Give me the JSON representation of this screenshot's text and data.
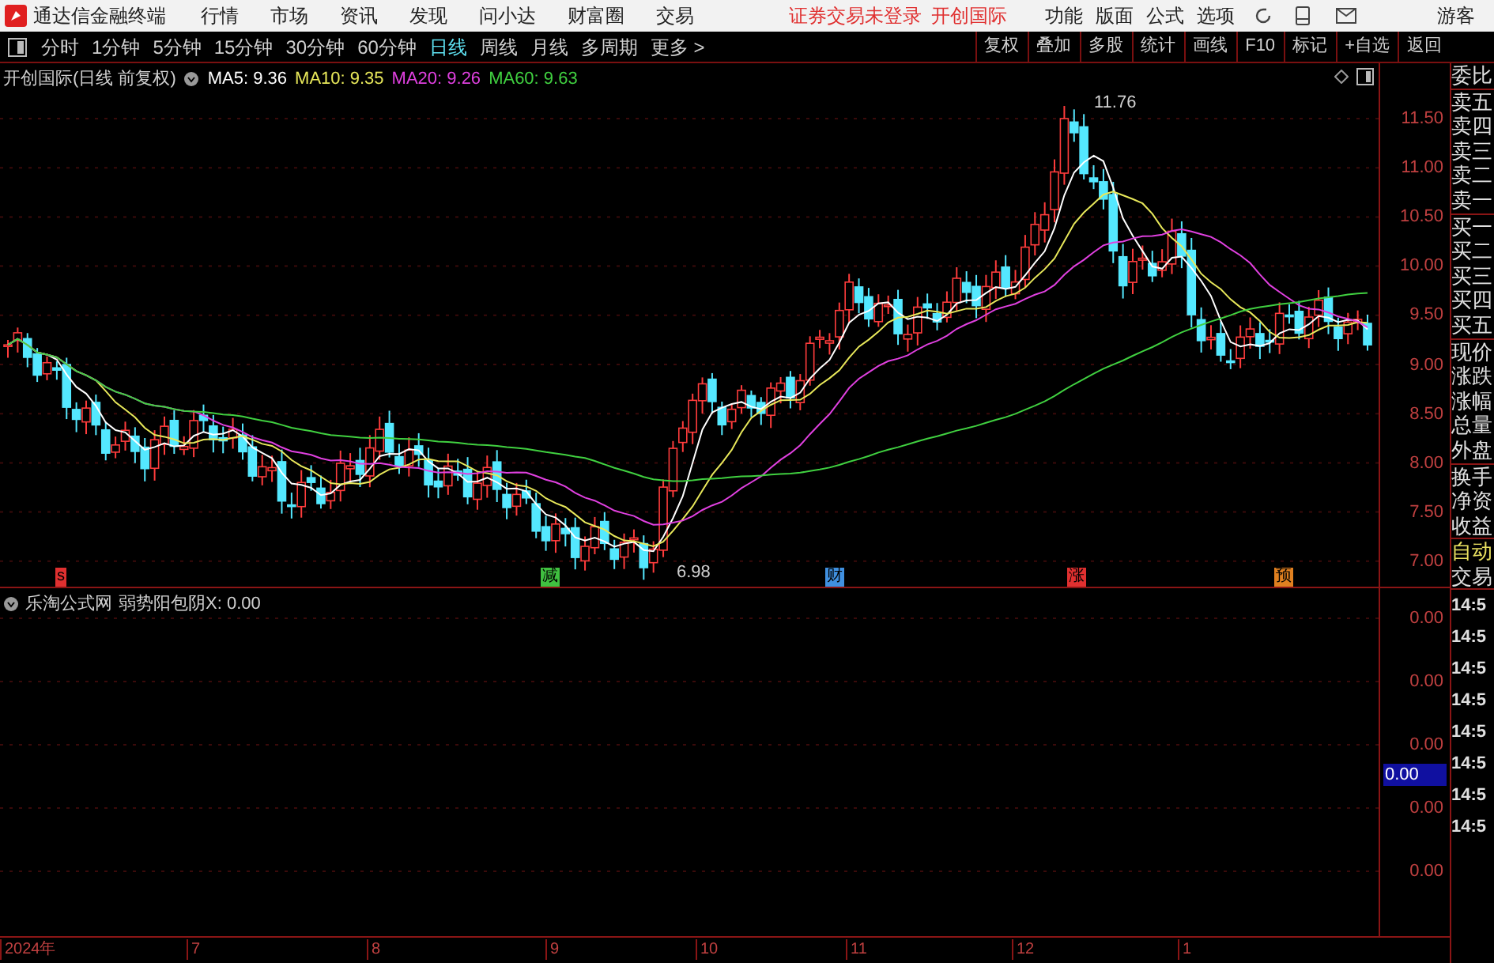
{
  "menu_bar": {
    "app_title": "通达信金融终端",
    "items": [
      "行情",
      "市场",
      "资讯",
      "发现",
      "问小达",
      "财富圈",
      "交易"
    ],
    "login_notice": "证券交易未登录",
    "broker": "开创国际",
    "right_items": [
      "功能",
      "版面",
      "公式",
      "选项"
    ],
    "user": "游客"
  },
  "period_tabs": [
    {
      "label": "分时",
      "selected": false
    },
    {
      "label": "1分钟",
      "selected": false
    },
    {
      "label": "5分钟",
      "selected": false
    },
    {
      "label": "15分钟",
      "selected": false
    },
    {
      "label": "30分钟",
      "selected": false
    },
    {
      "label": "60分钟",
      "selected": false
    },
    {
      "label": "日线",
      "selected": true
    },
    {
      "label": "周线",
      "selected": false
    },
    {
      "label": "月线",
      "selected": false
    },
    {
      "label": "多周期",
      "selected": false
    },
    {
      "label": "更多 >",
      "selected": false
    }
  ],
  "tool_buttons": [
    "复权",
    "叠加",
    "多股",
    "统计",
    "画线",
    "F10",
    "标记",
    "+自选",
    "返回"
  ],
  "main_chart": {
    "title": "开创国际(日线 前复权)",
    "legend": [
      {
        "label": "MA5: 9.36",
        "color": "#ffffff"
      },
      {
        "label": "MA10: 9.35",
        "color": "#e8e85a"
      },
      {
        "label": "MA20: 9.26",
        "color": "#e040e0"
      },
      {
        "label": "MA60: 9.63",
        "color": "#40d040"
      }
    ],
    "y_ticks": [
      "11.50",
      "11.00",
      "10.50",
      "10.00",
      "9.50",
      "9.00",
      "8.50",
      "8.00",
      "7.50",
      "7.00"
    ],
    "high_label": "11.76",
    "low_label": "6.98",
    "markers": [
      {
        "label": "s",
        "color": "#e03030"
      },
      {
        "label": "减",
        "color": "#40c040"
      },
      {
        "label": "财",
        "color": "#4090e0"
      },
      {
        "label": "涨",
        "color": "#e03030"
      },
      {
        "label": "预",
        "color": "#e08020"
      }
    ]
  },
  "sub_chart": {
    "source": "乐淘公式网",
    "formula": "弱势阳包阴X: 0.00",
    "y_ticks": [
      "0.00",
      "0.00",
      "0.00",
      "0.00",
      "0.00"
    ],
    "cursor_value": "0.00"
  },
  "x_axis": [
    "2024年",
    "7",
    "8",
    "9",
    "10",
    "11",
    "12",
    "1"
  ],
  "side_panel": {
    "quote_groups": [
      [
        "委比"
      ],
      [
        "卖五",
        "卖四",
        "卖三",
        "卖二",
        "卖一"
      ],
      [
        "买一",
        "买二",
        "买三",
        "买四",
        "买五"
      ],
      [
        "现价",
        "涨跌",
        "涨幅",
        "总量",
        "外盘"
      ],
      [
        "换手",
        "净资",
        "收益"
      ]
    ],
    "auto_label": "自动",
    "trade_label": "交易",
    "times": [
      "14:5",
      "14:5",
      "14:5",
      "14:5",
      "14:5",
      "14:5",
      "14:5",
      "14:5"
    ]
  }
}
